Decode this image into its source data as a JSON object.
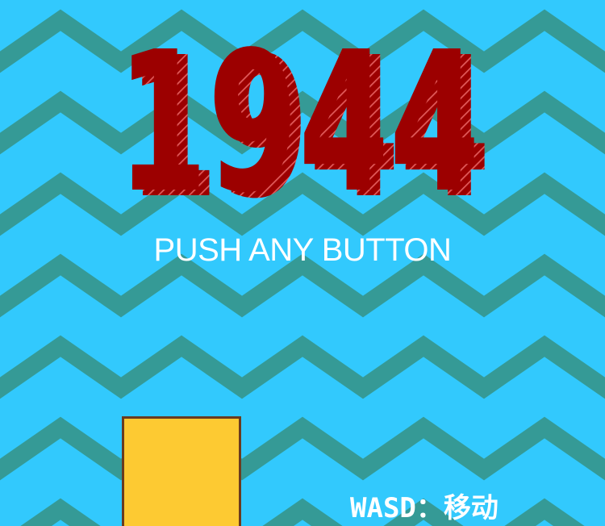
{
  "game": {
    "title": "1944",
    "prompt": "PUSH ANY BUTTON",
    "controls_hint": "WASD：移动"
  },
  "colors": {
    "sea": "#32c9fd",
    "waves": "#359a96",
    "title_fill": "#9c0000",
    "title_hatch": "#c71010",
    "prompt_text": "#ffffff",
    "player_fill": "#fdca32",
    "player_border": "#6b3b1e"
  }
}
